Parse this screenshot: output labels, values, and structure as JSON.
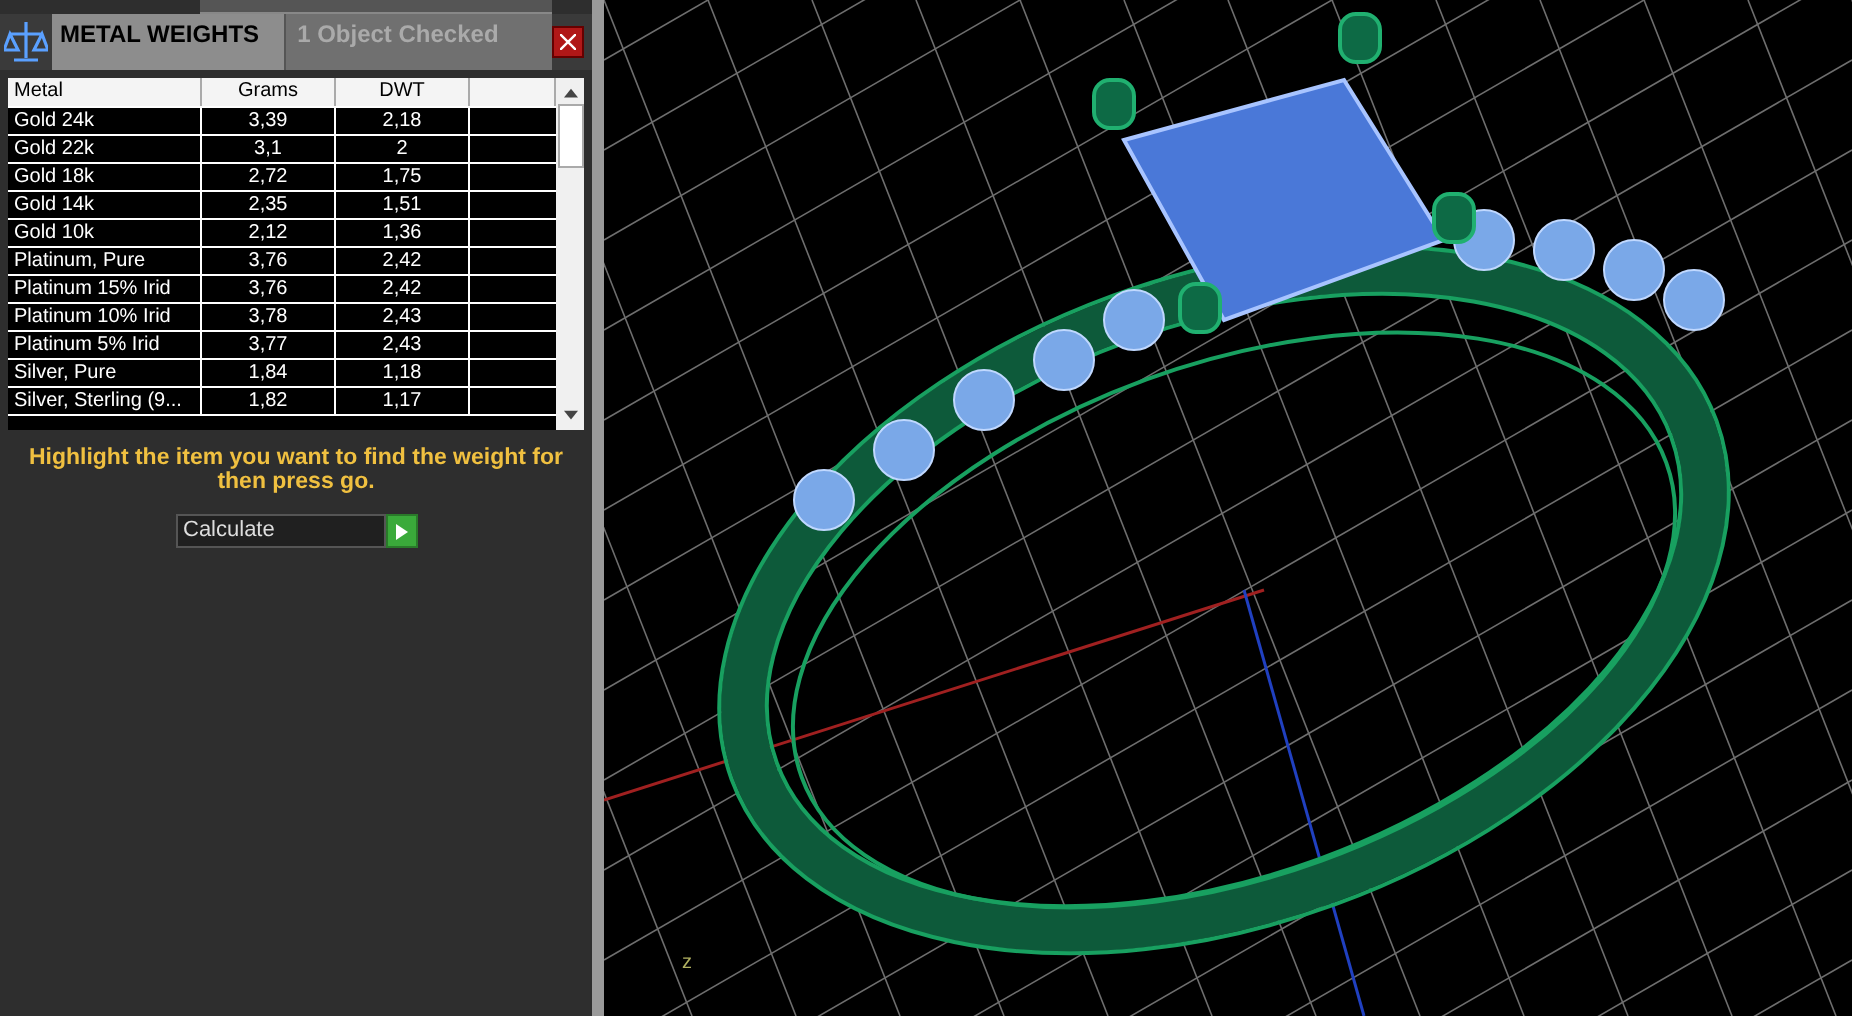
{
  "panel": {
    "title": "METAL WEIGHTS",
    "status": "1 Object Checked"
  },
  "table": {
    "columns": [
      "Metal",
      "Grams",
      "DWT"
    ],
    "rows": [
      {
        "cells": [
          "Gold 24k",
          "3,39",
          "2,18"
        ]
      },
      {
        "cells": [
          "Gold 22k",
          "3,1",
          "2"
        ]
      },
      {
        "cells": [
          "Gold 18k",
          "2,72",
          "1,75"
        ]
      },
      {
        "cells": [
          "Gold 14k",
          "2,35",
          "1,51"
        ]
      },
      {
        "cells": [
          "Gold 10k",
          "2,12",
          "1,36"
        ]
      },
      {
        "cells": [
          "Platinum, Pure",
          "3,76",
          "2,42"
        ]
      },
      {
        "cells": [
          "Platinum 15% Irid",
          "3,76",
          "2,42"
        ]
      },
      {
        "cells": [
          "Platinum 10% Irid",
          "3,78",
          "2,43"
        ]
      },
      {
        "cells": [
          "Platinum 5% Irid",
          "3,77",
          "2,43"
        ]
      },
      {
        "cells": [
          "Silver, Pure",
          "1,84",
          "1,18"
        ]
      },
      {
        "cells": [
          "Silver, Sterling (9...",
          "1,82",
          "1,17"
        ]
      }
    ]
  },
  "instruction": "Highlight the item you want to find the weight for then press go.",
  "calculate": {
    "value": "Calculate"
  },
  "viewport": {
    "axis_label": "z"
  }
}
